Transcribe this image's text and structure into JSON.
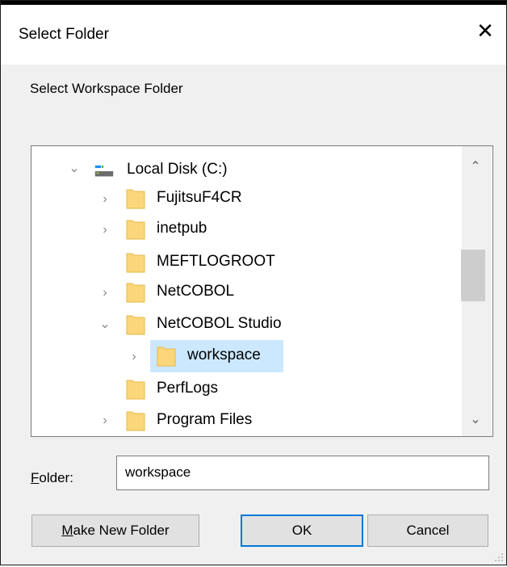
{
  "dialog": {
    "title": "Select Folder",
    "instruction": "Select Workspace Folder",
    "close_glyph": "✕"
  },
  "tree": {
    "root": {
      "label": "Local Disk (C:)",
      "icon": "drive-icon",
      "expanded": true
    },
    "items": [
      {
        "label": "FujitsuF4CR",
        "expander": "collapsed"
      },
      {
        "label": "inetpub",
        "expander": "collapsed"
      },
      {
        "label": "MEFTLOGROOT",
        "expander": "none"
      },
      {
        "label": "NetCOBOL",
        "expander": "collapsed"
      },
      {
        "label": "NetCOBOL Studio",
        "expander": "expanded"
      },
      {
        "label": "workspace",
        "expander": "collapsed",
        "selected": true
      },
      {
        "label": "PerfLogs",
        "expander": "none"
      },
      {
        "label": "Program Files",
        "expander": "collapsed"
      }
    ]
  },
  "folder": {
    "label_accel": "F",
    "label_rest": "older:",
    "value": "workspace"
  },
  "buttons": {
    "make_new_folder_accel": "M",
    "make_new_folder_rest": "ake New Folder",
    "ok": "OK",
    "cancel": "Cancel"
  },
  "colors": {
    "selection": "#cce8ff",
    "default_button_border": "#0078d7",
    "folder_fill": "#fbd67a"
  }
}
